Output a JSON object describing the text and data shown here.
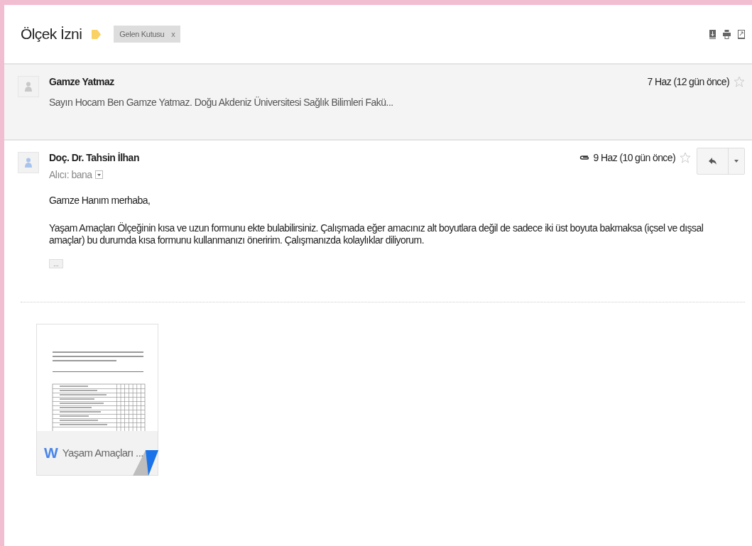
{
  "thread": {
    "subject": "Ölçek İzni",
    "label": {
      "name": "Gelen Kutusu",
      "remove": "x"
    }
  },
  "messages": [
    {
      "kind": "collapsed",
      "sender": "Gamze Yatmaz",
      "snippet": "Sayın Hocam Ben Gamze Yatmaz. Doğu Akdeniz Üniversitesi Sağlık Bilimleri Fakü...",
      "date": "7 Haz (12 gün önce)",
      "starred": false,
      "has_attachment": false
    },
    {
      "kind": "expanded",
      "sender": "Doç. Dr. Tahsin İlhan",
      "recipient": "Alıcı: bana",
      "date": "9 Haz (10 gün önce)",
      "starred": false,
      "has_attachment": true,
      "greeting": "Gamze Hanım merhaba,",
      "body": "Yaşam Amaçları Ölçeğinin kısa ve uzun formunu ekte bulabilirsiniz. Çalışmada eğer amacınız alt boyutlara değil de sadece iki üst boyuta bakmaksa (içsel ve dışsal amaçlar) bu durumda kısa formunu kullanmanızı öneririm. Çalışmanızda kolaylıklar diliyorum.",
      "more": "...",
      "attachments": [
        {
          "file_icon": "W",
          "name": "Yaşam Amaçları ..."
        }
      ]
    }
  ]
}
